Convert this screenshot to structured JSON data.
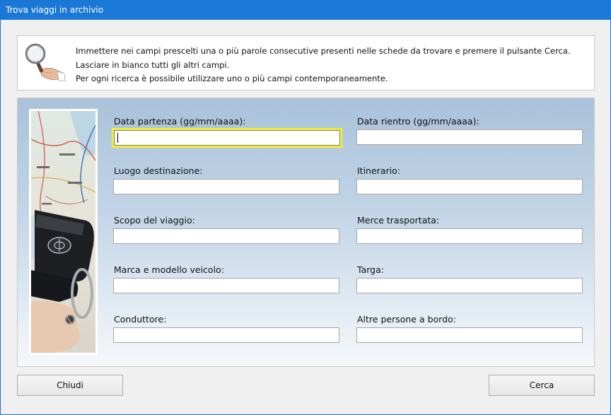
{
  "window": {
    "title": "Trova viaggi in archivio"
  },
  "info": {
    "icon": "magnifier-hand-icon",
    "lines": [
      "Immettere nei campi prescelti una o più parole consecutive presenti nelle schede da trovare e premere il pulsante Cerca.",
      "Lasciare in bianco tutti gli altri campi.",
      "Per ogni ricerca è possibile utilizzare uno o più campi contemporaneamente."
    ]
  },
  "fields": {
    "data_partenza": {
      "label": "Data partenza (gg/mm/aaaa):",
      "value": ""
    },
    "data_rientro": {
      "label": "Data rientro (gg/mm/aaaa):",
      "value": ""
    },
    "luogo_destinazione": {
      "label": "Luogo destinazione:",
      "value": ""
    },
    "itinerario": {
      "label": "Itinerario:",
      "value": ""
    },
    "scopo_viaggio": {
      "label": "Scopo del viaggio:",
      "value": ""
    },
    "merce_trasportata": {
      "label": "Merce trasportata:",
      "value": ""
    },
    "marca_modello": {
      "label": "Marca e modello veicolo:",
      "value": ""
    },
    "targa": {
      "label": "Targa:",
      "value": ""
    },
    "conduttore": {
      "label": "Conduttore:",
      "value": ""
    },
    "altre_persone": {
      "label": "Altre persone a bordo:",
      "value": ""
    }
  },
  "buttons": {
    "close": "Chiudi",
    "search": "Cerca"
  },
  "colors": {
    "titlebar": "#1a78d6",
    "focus_ring": "#f4ef2a"
  }
}
